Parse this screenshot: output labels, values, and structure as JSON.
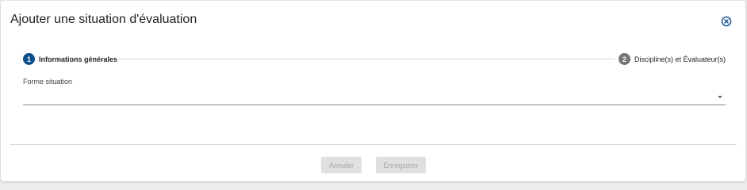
{
  "dialog": {
    "title": "Ajouter une situation d'évaluation",
    "close_icon": "close-circle-icon"
  },
  "stepper": {
    "steps": [
      {
        "number": "1",
        "label": "Informations générales",
        "state": "active",
        "color": "#0d4f8b"
      },
      {
        "number": "2",
        "label": "Discipline(s) et Évaluateur(s)",
        "state": "inactive",
        "color": "#757575"
      }
    ]
  },
  "form": {
    "forme_situation": {
      "label": "Forme situation",
      "value": "",
      "icon": "dropdown-arrow-icon"
    }
  },
  "actions": {
    "cancel_label": "Annuler",
    "save_label": "Enregistrer",
    "disabled": true
  },
  "colors": {
    "accent": "#0d4f8b",
    "disabled_bg": "#e0e0e0",
    "disabled_text": "#a6a6a6"
  }
}
